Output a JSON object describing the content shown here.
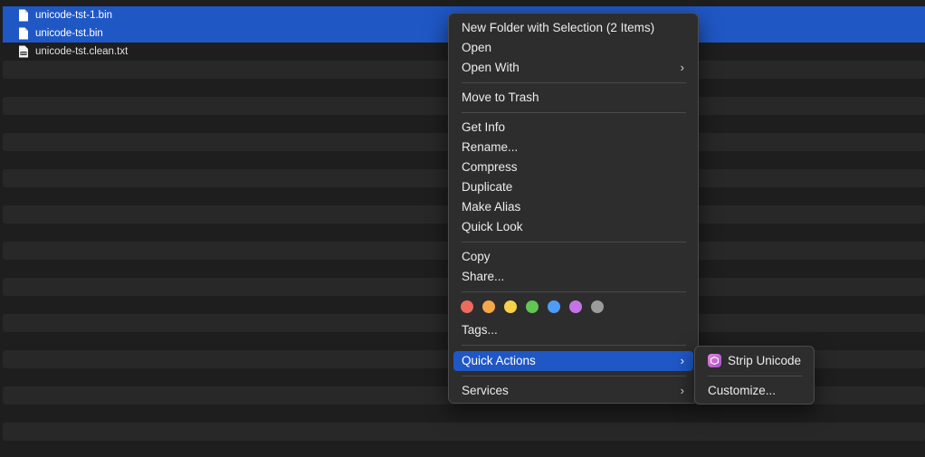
{
  "files": [
    {
      "name": "unicode-tst-1.bin",
      "icon": "document-icon",
      "selected": true
    },
    {
      "name": "unicode-tst.bin",
      "icon": "document-icon",
      "selected": true
    },
    {
      "name": "unicode-tst.clean.txt",
      "icon": "text-file-icon",
      "selected": false
    }
  ],
  "context_menu": {
    "new_folder": "New Folder with Selection (2 Items)",
    "open": "Open",
    "open_with": "Open With",
    "move_to_trash": "Move to Trash",
    "get_info": "Get Info",
    "rename": "Rename...",
    "compress": "Compress",
    "duplicate": "Duplicate",
    "make_alias": "Make Alias",
    "quick_look": "Quick Look",
    "copy": "Copy",
    "share": "Share...",
    "tags": "Tags...",
    "quick_actions": "Quick Actions",
    "services": "Services",
    "tag_colors": [
      "#ec6a5e",
      "#f3a84b",
      "#f5d24a",
      "#62c554",
      "#4f9cf6",
      "#c574e8",
      "#9b9b9b"
    ]
  },
  "quick_actions_submenu": {
    "strip_unicode": "Strip Unicode",
    "customize": "Customize..."
  },
  "colors": {
    "selection": "#1f57c5",
    "background": "#1e1e1e",
    "menu": "#2d2d2d"
  }
}
